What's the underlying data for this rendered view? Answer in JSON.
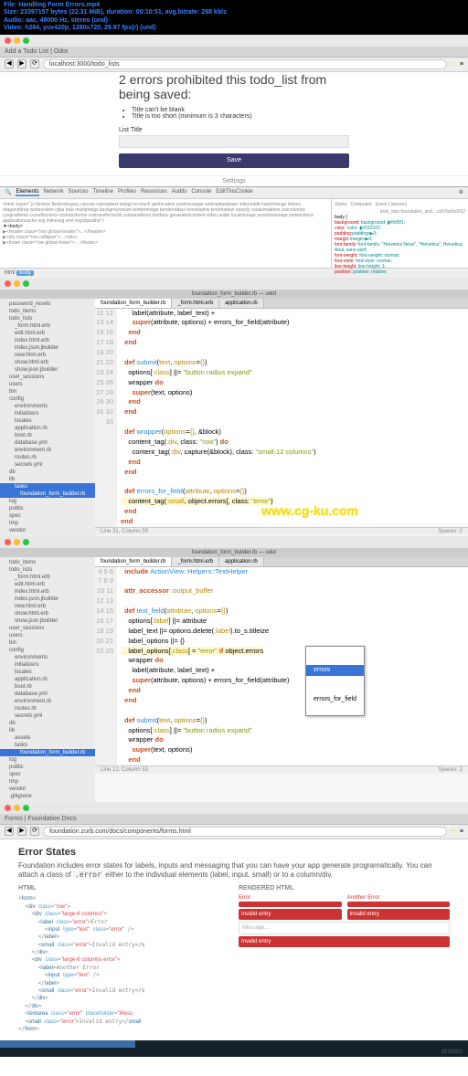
{
  "video": {
    "file": "File: Handling Form Errors.mp4",
    "size": "Size: 23397157 bytes (22.31 MiB), duration: 00:10:51, avg.bitrate: 288 kb/s",
    "audio": "Audio: aac, 48000 Hz, stereo (und)",
    "vid": "Video: h264, yuv420p, 1280x720, 29.97 fps(r) (und)"
  },
  "browser1": {
    "tab": "Add a Todo List | Odot",
    "url": "localhost:3000/todo_lists",
    "heading": "2 errors prohibited this todo_list from being saved:",
    "err1": "Title can't be blank",
    "err2": "Title is too short (minimum is 3 characters)",
    "label": "List Title",
    "save": "Save",
    "settings": "Settings"
  },
  "devtools": {
    "tabs": [
      "Elements",
      "Network",
      "Sources",
      "Timeline",
      "Profiles",
      "Resources",
      "Audits",
      "Console",
      "EditThisCookie"
    ],
    "html": "<html class=\" js flexbox flexboxlegacy canvas canvastext webgl no-touch geolocation postmessage websqldatabase indexeddb hashchange history draganddrop websockets rgba hsla multiplebgs backgroundsize borderimage borderradius boxshadow textshadow opacity cssanimations csscolumns cssgradients cssreflections csstransforms csstransforms3d csstransitions fontface generatedcontent video audio localstorage sessionstorage webworkers applicationcache svg inlinesvg smil svgclippaths\">",
    "body_open": "▼<body>",
    "header": "  ▶<header class=\"row global-header\">…</header>",
    "div": "  ▶<div class=\"row collapse\">…</div>",
    "footer": "  ▶<footer class=\"row global-footer\">…</footer>",
    "style_tabs": [
      "Styles",
      "Computed",
      "Event Listeners"
    ],
    "style_body": "body {",
    "s1": "background: ▮#fcf0f1;",
    "s2": "color: ▮#222222;",
    "s3": "padding:▶0;",
    "s4": "margin:▶0;",
    "s5": "font-family: \"Helvetica Neue\", \"Helvetica\", Helvetica, Arial, sans-serif;",
    "s6": "font-weight: normal;",
    "s7": "font-style: normal;",
    "s8": "line-height: 1;",
    "s9": "position: relative;",
    "crumbs_html": "html",
    "crumbs_body": "body",
    "link": "foundation_and…cs57be5c9:62",
    "link2": "todo_lists"
  },
  "editor1": {
    "title": "foundation_form_builder.rb — odot",
    "tab1": "foundation_form_builder.rb",
    "tab2": "_form.html.erb",
    "tab3": "application.rb",
    "status": "Line 31, Column 59",
    "spaces": "Spaces: 2",
    "sidebar": {
      "password_resets": "password_resets",
      "todo_items": "todo_items",
      "todo_lists": "todo_lists",
      "form": "_form.html.erb",
      "edit": "edit.html.erb",
      "index": "index.html.erb",
      "indexj": "index.json.jbuilder",
      "new": "new.html.erb",
      "show": "show.html.erb",
      "showj": "show.json.jbuilder",
      "user_sessions": "user_sessions",
      "users": "users",
      "bin": "bin",
      "config": "config",
      "environments": "environments",
      "initializers": "initializers",
      "locales": "locales",
      "apprb": "application.rb",
      "bootrb": "boot.rb",
      "dbyml": "database.yml",
      "envrb": "environment.rb",
      "routes": "routes.rb",
      "secrets": "secrets.yml",
      "db": "db",
      "lib": "lib",
      "tasks": "tasks",
      "ffb": "foundation_form_builder.rb",
      "log": "log",
      "public": "public",
      "spec": "spec",
      "tmp": "tmp",
      "vendor": "vendor"
    }
  },
  "editor2": {
    "title": "foundation_form_builder.rb — odot",
    "status": "Line 12, Column 53",
    "spaces": "Spaces: 2",
    "ac1": "errors",
    "ac2": "errors_for_field",
    "sidebar_extra": {
      "assets": "assets",
      "gitignore": ".gitignore"
    }
  },
  "browser2": {
    "tab": "Forms | Foundation Docs",
    "url": "foundation.zurb.com/docs/components/forms.html"
  },
  "docs": {
    "title": "Error States",
    "desc": "Foundation includes error states for labels, inputs and messaging that you can have your app generate programatically. You can attach a class of ",
    "errorclass": ".error",
    "desc2": " either to the individual elements (label, input, small) or to a column/div.",
    "html_h": "HTML",
    "rend_h": "RENDERED HTML",
    "err_label": "Error",
    "another": "Another Error",
    "invalid": "Invalid entry",
    "msg": "Message..."
  },
  "watermark": "www.cg-ku.com",
  "copyright": "2019/3/2"
}
